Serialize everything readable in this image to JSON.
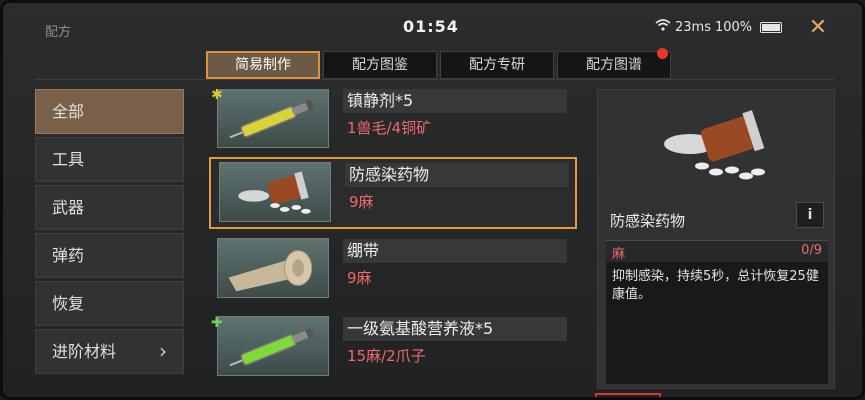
{
  "window": {
    "title": "配方",
    "clock": "01:54",
    "latency": "23ms",
    "battery": "100%"
  },
  "tabs": [
    {
      "label": "简易制作",
      "active": true
    },
    {
      "label": "配方图鉴"
    },
    {
      "label": "配方专研"
    },
    {
      "label": "配方图谱",
      "notification": true
    }
  ],
  "sidebar": {
    "items": [
      {
        "label": "全部",
        "active": true
      },
      {
        "label": "工具"
      },
      {
        "label": "武器"
      },
      {
        "label": "弹药"
      },
      {
        "label": "恢复"
      },
      {
        "label": "进阶材料",
        "chevron": "›"
      }
    ]
  },
  "recipes": [
    {
      "name": "镇静剂*5",
      "cost": "1兽毛/4铜矿",
      "badge": "✱",
      "icon": "syringe-yellow-icon"
    },
    {
      "name": "防感染药物",
      "cost": "9麻",
      "icon": "pill-bottle-icon",
      "selected": true
    },
    {
      "name": "绷带",
      "cost": "9麻",
      "icon": "bandage-icon"
    },
    {
      "name": "一级氨基酸营养液*5",
      "cost": "15麻/2爪子",
      "badge": "✚",
      "icon": "syringe-green-icon"
    }
  ],
  "detail": {
    "name": "防感染药物",
    "info_label": "i",
    "material": {
      "name": "麻",
      "count": "0/9"
    },
    "description": "抑制感染，持续5秒，总计恢复25健康值。"
  },
  "colors": {
    "accent": "#e59a3b",
    "cost_red": "#ee6a6a",
    "active_tab": "#6d5a45"
  }
}
